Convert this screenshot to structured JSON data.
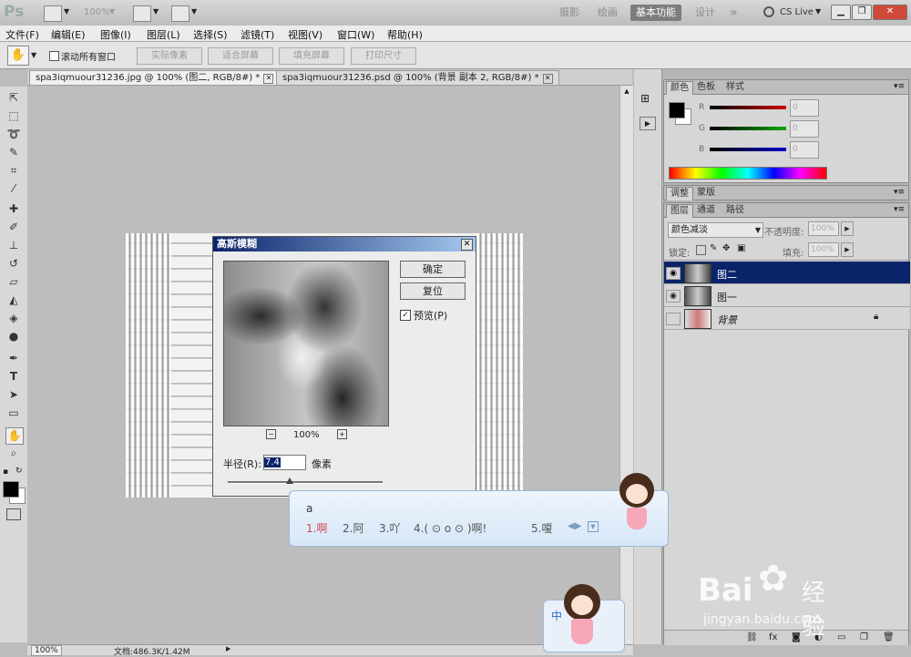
{
  "appbar": {
    "logo": "Ps",
    "zoom": "100%",
    "workspaces": [
      "摄影",
      "绘画",
      "基本功能",
      "设计"
    ],
    "active_workspace": "基本功能",
    "more": "»",
    "cs_live": "CS Live"
  },
  "menubar": {
    "items": [
      "文件(F)",
      "编辑(E)",
      "图像(I)",
      "图层(L)",
      "选择(S)",
      "滤镜(T)",
      "视图(V)",
      "窗口(W)",
      "帮助(H)"
    ]
  },
  "options": {
    "scroll_all": "滚动所有窗口",
    "buttons": [
      "实际像素",
      "适合屏幕",
      "填充屏幕",
      "打印尺寸"
    ]
  },
  "tabs": [
    {
      "label": "spa3iqmuour31236.jpg @ 100% (图二, RGB/8#) *"
    },
    {
      "label": "spa3iqmuour31236.psd @ 100% (背景 副本 2, RGB/8#) *"
    }
  ],
  "dialog": {
    "title": "高斯模糊",
    "ok": "确定",
    "reset": "复位",
    "preview": "预览(P)",
    "zoom_minus": "−",
    "zoom": "100%",
    "zoom_plus": "+",
    "radius_label": "半径(R):",
    "radius_value": "7.4",
    "unit": "像素",
    "slider_fraction": 0.4
  },
  "color_panel": {
    "tabs": [
      "颜色",
      "色板",
      "样式"
    ],
    "channels": [
      {
        "label": "R",
        "value": "0",
        "color": "#cc0000"
      },
      {
        "label": "G",
        "value": "0",
        "color": "#00aa00"
      },
      {
        "label": "B",
        "value": "0",
        "color": "#0000cc"
      }
    ]
  },
  "adjust_panel": {
    "tabs": [
      "调整",
      "蒙版"
    ]
  },
  "layers_panel": {
    "tabs": [
      "图层",
      "通道",
      "路径"
    ],
    "blend_mode": "颜色减淡",
    "opacity_label": "不透明度:",
    "opacity": "100%",
    "lock_label": "锁定:",
    "fill_label": "填充:",
    "fill": "100%",
    "layers": [
      {
        "name": "图二",
        "selected": true,
        "visible": true
      },
      {
        "name": "图一",
        "selected": false,
        "visible": true
      },
      {
        "name": "背景",
        "selected": false,
        "visible": false,
        "locked": true
      }
    ]
  },
  "status": {
    "zoom": "100%",
    "doc": "文档:486.3K/1.42M"
  },
  "ime": {
    "input": "a",
    "candidates": [
      "1.啊",
      "2.阿",
      "3.吖",
      "4.( ⊙ o ⊙ )啊!",
      "5.嗄"
    ],
    "mode": "中"
  },
  "watermark": {
    "brand": "Bai",
    "brand2": "经验",
    "url": "jingyan.baidu.com"
  }
}
